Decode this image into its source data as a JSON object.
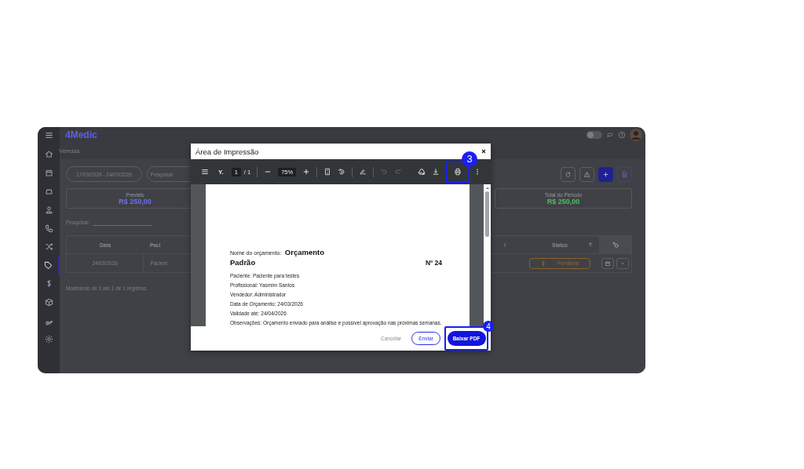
{
  "app": {
    "logo": "4Medic",
    "breadcrumb": "Vendas"
  },
  "sidebar": {
    "items": [
      {
        "selected": false
      },
      {
        "selected": false
      },
      {
        "selected": false
      },
      {
        "selected": false
      },
      {
        "selected": false
      },
      {
        "selected": false
      },
      {
        "selected": true
      },
      {
        "selected": false
      },
      {
        "selected": false
      },
      {
        "selected": false
      },
      {
        "selected": false
      }
    ]
  },
  "topbar": {
    "theme_toggle": {
      "on": false
    }
  },
  "filters": {
    "date_range": "17/03/2026 - 24/03/2026",
    "search_placeholder": "Pesquisar"
  },
  "summary_cards": [
    {
      "label": "Previsto",
      "value": "R$ 250,00",
      "color": "#6a70f0"
    },
    {
      "label": "Total do Período",
      "value": "R$ 250,00",
      "color": "#4cc060"
    }
  ],
  "table_search": {
    "label": "Pesquisar:"
  },
  "table": {
    "columns_left": [
      "Data",
      "Paci"
    ],
    "column_right_cut": "!",
    "status_column": "Status",
    "rows": [
      {
        "cells": [
          "24/03/2026",
          "Pacient"
        ],
        "status": "Pendente"
      }
    ]
  },
  "pagination_info": "Mostrando de 1 até 1 de 1 registros",
  "dialog": {
    "title": "Área de Impressão",
    "toolbar": {
      "document_title": "Y.",
      "page": "1",
      "page_separator": "/ 1",
      "zoom": "75%",
      "undo": {
        "disabled": true
      },
      "redo": {
        "disabled": true
      }
    },
    "document": {
      "name_label": "Nome do orçamento:",
      "name": "Orçamento Padrão",
      "number": "Nº 24",
      "lines": [
        "Paciente: Paciente para testes",
        "Profissional: Yasmim Santos",
        "Vendedor: Administrador",
        "Data de Orçamento: 24/03/2026",
        "Validade até: 24/04/2026",
        "Observações: Orçamento enviado para análise e possível aprovação nas próximas semanas."
      ]
    },
    "buttons": [
      {
        "label": "Cancelar",
        "kind": "text"
      },
      {
        "label": "Enviar",
        "kind": "outline"
      },
      {
        "label": "Baixar PDF",
        "kind": "primary"
      }
    ]
  },
  "annotations": [
    {
      "number": "3"
    },
    {
      "number": "4"
    }
  ]
}
